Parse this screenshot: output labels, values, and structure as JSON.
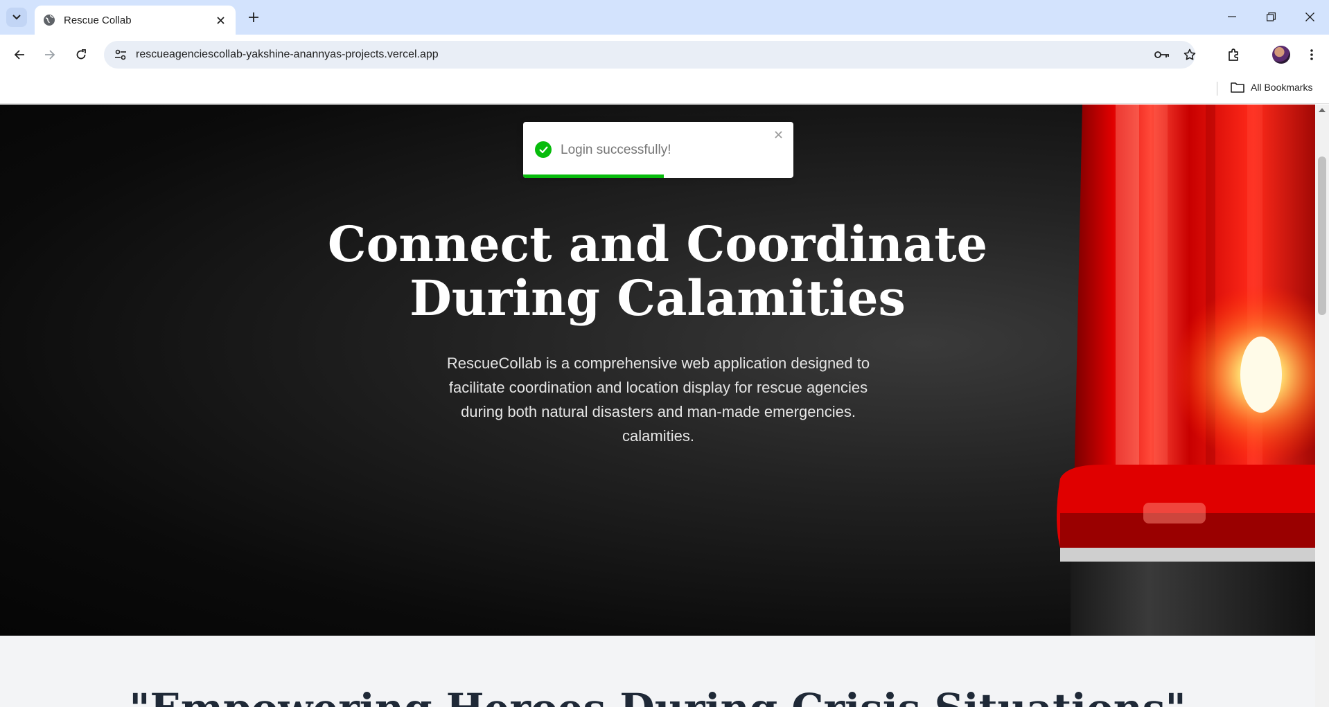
{
  "browser": {
    "tab_title": "Rescue Collab",
    "url": "rescueagenciescollab-yakshine-anannyas-projects.vercel.app",
    "bookmarks_label": "All Bookmarks"
  },
  "toast": {
    "message": "Login successfully!",
    "progress_fraction": 0.52,
    "accent_color": "#07bc0c"
  },
  "hero": {
    "title_line1": "Connect and Coordinate",
    "title_line2": "During Calamities",
    "description": "RescueCollab is a comprehensive web application designed to facilitate coordination and location display for rescue agencies during both natural disasters and man-made emergencies. calamities."
  },
  "section2": {
    "title": "\"Empowering Heroes During Crisis Situations\""
  }
}
